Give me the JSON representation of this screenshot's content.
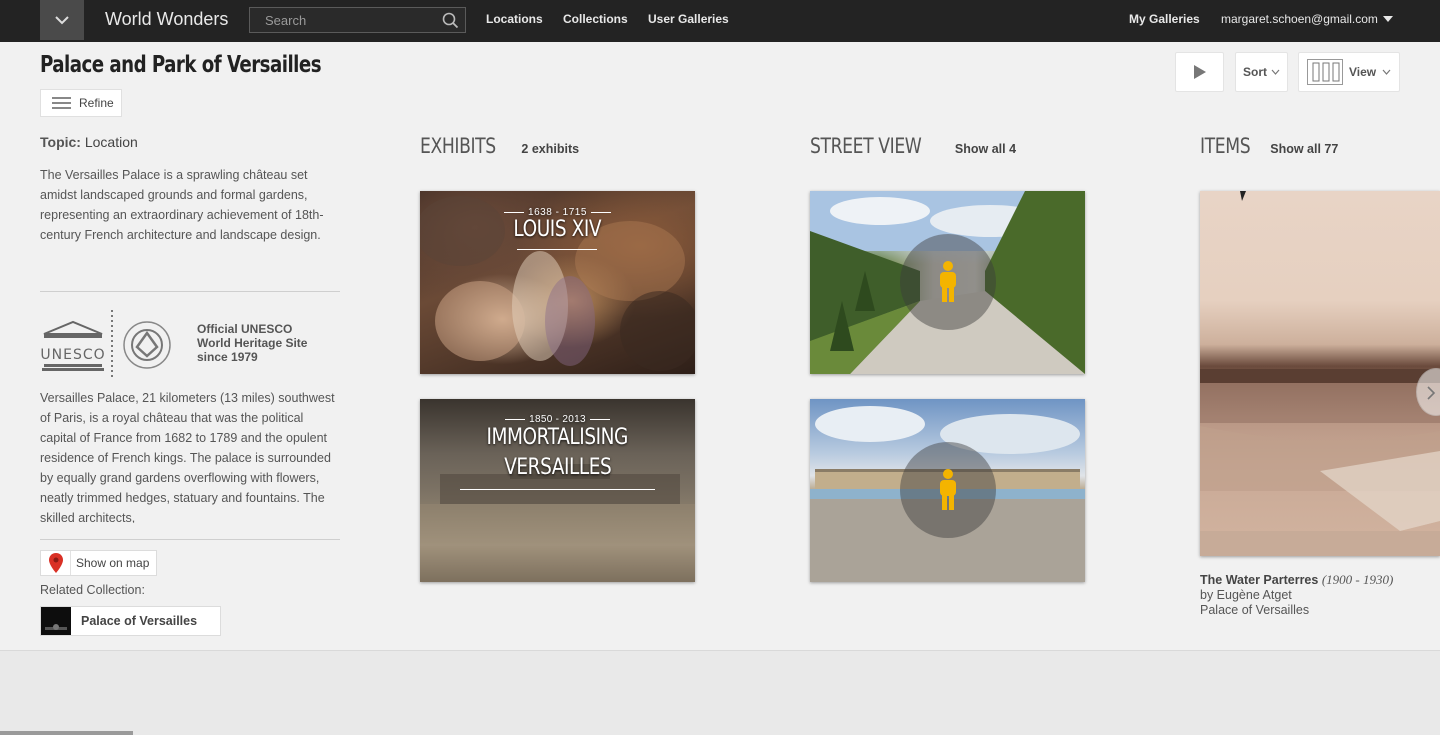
{
  "header": {
    "app_title": "World Wonders",
    "search_placeholder": "Search",
    "nav": [
      "Locations",
      "Collections",
      "User Galleries"
    ],
    "my_galleries": "My Galleries",
    "user_email": "margaret.schoen@gmail.com"
  },
  "page": {
    "title": "Palace and Park of Versailles",
    "refine_label": "Refine",
    "sort_label": "Sort",
    "view_label": "View"
  },
  "sidebar": {
    "topic_label": "Topic:",
    "topic_value": "Location",
    "short_description": "The Versailles Palace is a sprawling château set amidst landscaped grounds and formal gardens, representing an extraordinary achievement of 18th-century French architecture and landscape design.",
    "unesco_line1": "Official UNESCO",
    "unesco_line2": "World Heritage Site",
    "unesco_line3": "since 1979",
    "unesco_logo_text": "UNESCO",
    "long_description": "Versailles Palace, 21 kilometers (13 miles) southwest of Paris, is a royal château that was the political capital of France from 1682 to 1789 and the opulent residence of French kings. The palace is surrounded by equally grand gardens overflowing with flowers, neatly trimmed hedges, statuary and fountains. The skilled architects,",
    "show_on_map": "Show on map",
    "related_label": "Related Collection:",
    "related_collection": "Palace of Versailles"
  },
  "exhibits": {
    "heading": "EXHIBITS",
    "count_label": "2 exhibits",
    "cards": [
      {
        "dates": "1638 - 1715",
        "title": "LOUIS XIV"
      },
      {
        "dates": "1850 - 2013",
        "title_line1": "IMMORTALISING",
        "title_line2": "VERSAILLES"
      }
    ]
  },
  "street_view": {
    "heading": "STREET VIEW",
    "show_all": "Show all 4"
  },
  "items": {
    "heading": "ITEMS",
    "show_all": "Show all 77",
    "first_item": {
      "title": "The Water Parterres",
      "date": "(1900 - 1930)",
      "by": "by Eugène Atget",
      "collection": "Palace of Versailles"
    }
  },
  "colors": {
    "topbar": "#232323",
    "pegman": "#f4b400",
    "map_pin": "#d93025"
  }
}
